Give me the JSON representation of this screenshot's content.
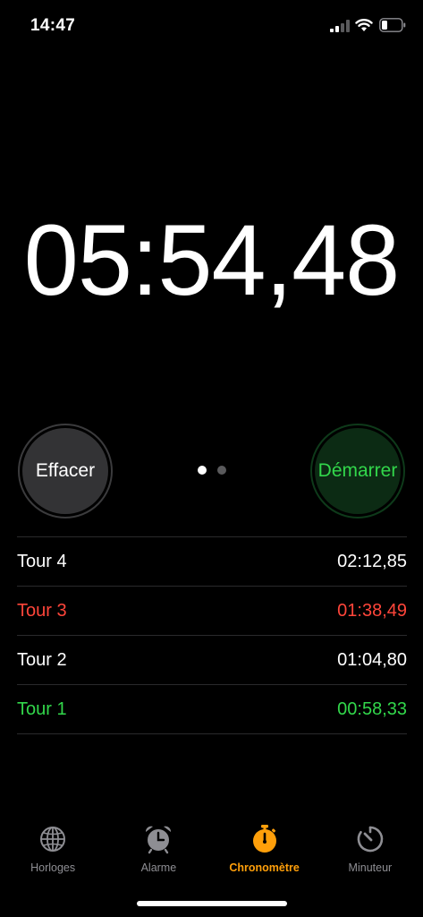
{
  "status_bar": {
    "time": "14:47"
  },
  "stopwatch": {
    "elapsed": "05:54,48"
  },
  "buttons": {
    "reset_label": "Effacer",
    "start_label": "Démarrer"
  },
  "pager": {
    "count": 2,
    "active_index": 0
  },
  "laps": [
    {
      "label": "Tour 4",
      "time": "02:12,85",
      "highlight": "none"
    },
    {
      "label": "Tour 3",
      "time": "01:38,49",
      "highlight": "slowest"
    },
    {
      "label": "Tour 2",
      "time": "01:04,80",
      "highlight": "none"
    },
    {
      "label": "Tour 1",
      "time": "00:58,33",
      "highlight": "fastest"
    }
  ],
  "tab_bar": {
    "tabs": [
      {
        "label": "Horloges",
        "icon": "globe-icon"
      },
      {
        "label": "Alarme",
        "icon": "alarm-clock-icon"
      },
      {
        "label": "Chronomètre",
        "icon": "stopwatch-icon"
      },
      {
        "label": "Minuteur",
        "icon": "timer-icon"
      }
    ],
    "active_index": 2
  },
  "colors": {
    "accent": "#ff9f0a",
    "start_green": "#32d74b",
    "slow_red": "#ff453a",
    "inactive_gray": "#8e8e93"
  }
}
